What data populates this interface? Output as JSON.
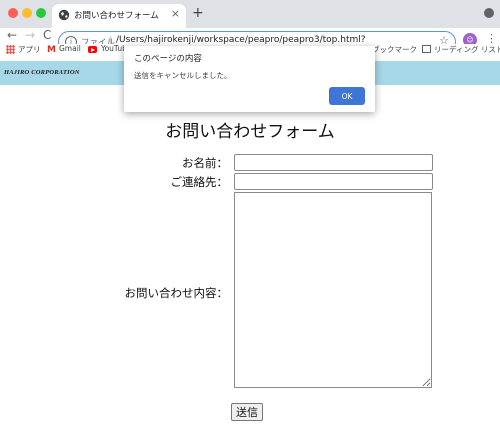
{
  "browser": {
    "tab": {
      "title": "お問い合わせフォーム",
      "close_glyph": "×",
      "new_tab_glyph": "+"
    },
    "nav": {
      "back_glyph": "←",
      "forward_glyph": "→",
      "reload_glyph": "C"
    },
    "address_bar": {
      "scheme_label": "ファイル",
      "url": "/Users/hajirokenji/workspace/peapro/peapro3/top.html?",
      "star_glyph": "☆",
      "info_glyph": "i"
    },
    "bookmarks": [
      {
        "label": "アプリ",
        "icon": "apps-icon"
      },
      {
        "label": "Gmail",
        "icon": "gmail-icon"
      },
      {
        "label": "YouTube",
        "icon": "youtube-icon"
      },
      {
        "label": "ブックマーク",
        "icon": ""
      },
      {
        "label": "リーディング リスト",
        "icon": "reading-list-icon"
      }
    ],
    "menu_glyph": "⋮",
    "colors": {
      "tab_strip": "#dee1e6",
      "close": "#ff5f57",
      "minimize": "#febc2e",
      "maximize": "#28c840",
      "focus_ring": "#5b8ff0"
    }
  },
  "dialog": {
    "title": "このページの内容",
    "message": "送信をキャンセルしました。",
    "ok_label": "OK",
    "ok_color": "#3e76d6"
  },
  "page": {
    "banner_text": "HAJIRO CORPORATION",
    "banner_color": "#a6d8e8",
    "title": "お問い合わせフォーム",
    "form": {
      "name_label": "お名前：",
      "name_value": "",
      "contact_label": "ご連絡先：",
      "contact_value": "",
      "inquiry_label": "お問い合わせ内容：",
      "inquiry_value": "",
      "submit_label": "送信"
    }
  }
}
